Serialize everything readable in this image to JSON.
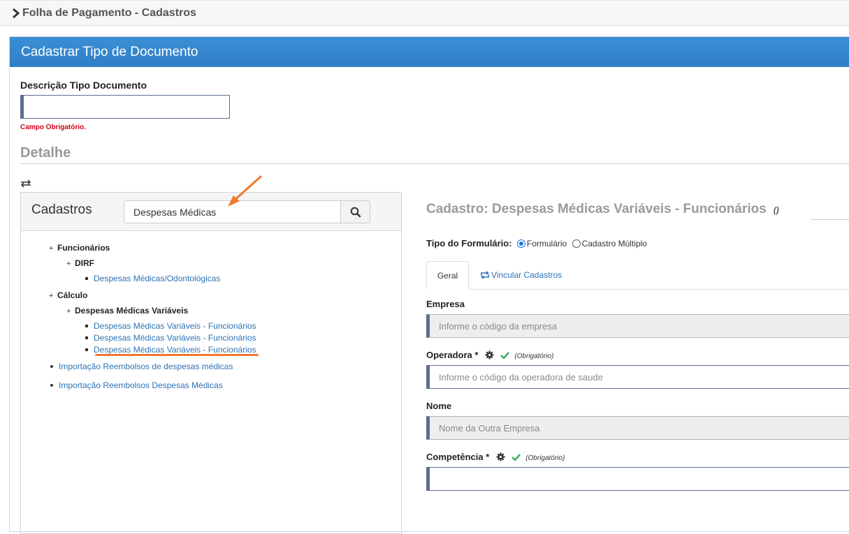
{
  "topbar": {
    "title": "Folha de Pagamento - Cadastros"
  },
  "panel": {
    "title": "Cadastrar Tipo de Documento"
  },
  "form": {
    "desc_label": "Descrição Tipo Documento",
    "desc_value": "",
    "required_msg": "Campo Obrigatório."
  },
  "detalhe": {
    "title": "Detalhe"
  },
  "cadastros": {
    "title": "Cadastros",
    "search_value": "Despesas Médicas",
    "tree": [
      {
        "sym": "+",
        "label": "Funcionários"
      },
      {
        "sym": "+",
        "label": "DIRF"
      },
      {
        "label": "Despesas Médicas/Odontológicas"
      },
      {
        "sym": "+",
        "label": "Cálculo"
      },
      {
        "sym": "+",
        "label": "Despesas Médicas Variáveis"
      },
      {
        "label": "Despesas Médicas Variáveis - Funcionários"
      },
      {
        "label": "Despesas Médicas Variáveis - Funcionários"
      },
      {
        "label": "Despesas Médicas Variáveis - Funcionários"
      },
      {
        "label": "Importação Reembolsos de despesas médicas"
      },
      {
        "label": "Importação Reembolsos Despesas Médicas"
      }
    ]
  },
  "right": {
    "title": "Cadastro: Despesas Médicas Variáveis - Funcionários",
    "title_suffix": "()",
    "tipo_label": "Tipo do Formulário:",
    "opt_formulario": "Formulário",
    "opt_multiplo": "Cadastro Múltiplo",
    "tab_geral": "Geral",
    "tab_vincular": "Vincular Cadastros",
    "empresa_label": "Empresa",
    "empresa_placeholder": "Informe o código da empresa",
    "operadora_label": "Operadora *",
    "operadora_req": "(Obrigatório)",
    "operadora_placeholder": "Informe o código da operadora de saude",
    "nome_label": "Nome",
    "nome_placeholder": "Nome da Outra Empresa",
    "competencia_label": "Competência *",
    "competencia_req": "(Obrigatório)",
    "competencia_value": ""
  },
  "colors": {
    "header_blue": "#2f7fc6",
    "required_red": "#d0021b",
    "link_blue": "#2d73b6",
    "annotation_orange": "#f07a30",
    "check_green": "#3cae60"
  }
}
